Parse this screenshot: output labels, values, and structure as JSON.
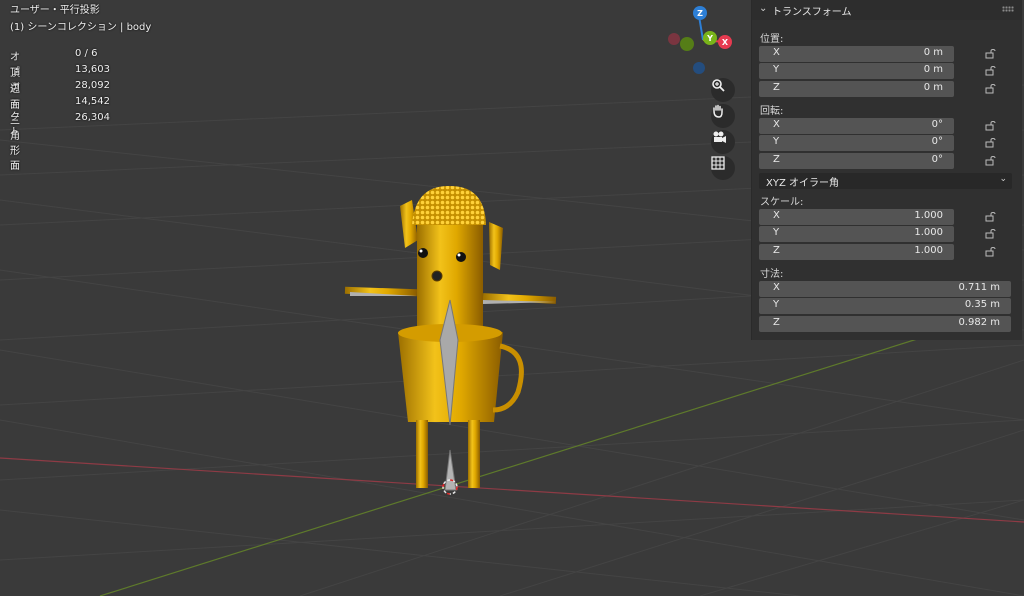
{
  "viewport": {
    "title": "ユーザー・平行投影",
    "subtitle": "(1) シーンコレクション | body",
    "stats": [
      {
        "label": "オブジェクト",
        "value": "0 / 6"
      },
      {
        "label": "頂点",
        "value": "13,603"
      },
      {
        "label": "辺",
        "value": "28,092"
      },
      {
        "label": "面",
        "value": "14,542"
      },
      {
        "label": "三角形面",
        "value": "26,304"
      }
    ]
  },
  "gizmo": {
    "z_label": "Z",
    "y_label": "Y",
    "x_label": "X",
    "colors": {
      "x": "#e63a50",
      "y": "#79b41a",
      "z": "#2d7fd6"
    }
  },
  "tools": [
    "zoom-icon",
    "hand-icon",
    "camera-icon",
    "grid-icon"
  ],
  "panel": {
    "title": "トランスフォーム",
    "location": {
      "label": "位置:",
      "fields": [
        {
          "axis": "X",
          "value": "0 m"
        },
        {
          "axis": "Y",
          "value": "0 m"
        },
        {
          "axis": "Z",
          "value": "0 m"
        }
      ]
    },
    "rotation": {
      "label": "回転:",
      "fields": [
        {
          "axis": "X",
          "value": "0°"
        },
        {
          "axis": "Y",
          "value": "0°"
        },
        {
          "axis": "Z",
          "value": "0°"
        }
      ]
    },
    "rotation_mode": "XYZ オイラー角",
    "scale": {
      "label": "スケール:",
      "fields": [
        {
          "axis": "X",
          "value": "1.000"
        },
        {
          "axis": "Y",
          "value": "1.000"
        },
        {
          "axis": "Z",
          "value": "1.000"
        }
      ]
    },
    "dimensions": {
      "label": "寸法:",
      "fields": [
        {
          "axis": "X",
          "value": "0.711 m"
        },
        {
          "axis": "Y",
          "value": "0.35 m"
        },
        {
          "axis": "Z",
          "value": "0.982 m"
        }
      ]
    }
  }
}
